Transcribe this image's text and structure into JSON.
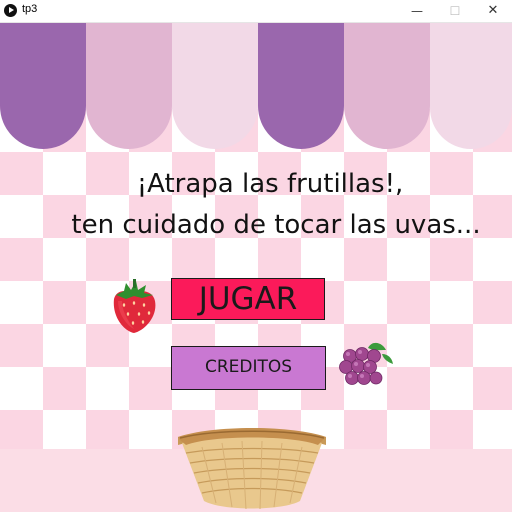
{
  "window": {
    "title": "tp3",
    "minimize_symbol": "—",
    "maximize_symbol": "☐",
    "close_symbol": "✕"
  },
  "awning": {
    "colors": [
      "#9a67ad",
      "#e1b5d1",
      "#f2d9e7",
      "#9a67ad",
      "#e1b5d1",
      "#f2d9e7"
    ]
  },
  "background": {
    "checker_color": "#fbd6e3",
    "floor_color": "#fbdde6"
  },
  "main": {
    "title_line1": "¡Atrapa las frutillas!,",
    "title_line2": "ten cuidado de tocar las uvas...",
    "play_label": "JUGAR",
    "credits_label": "CREDITOS"
  },
  "icons": {
    "strawberry": "strawberry-icon",
    "grape": "grape-icon",
    "basket": "basket-icon"
  },
  "colors": {
    "play_button": "#fb1a5a",
    "credits_button": "#c978d2"
  }
}
